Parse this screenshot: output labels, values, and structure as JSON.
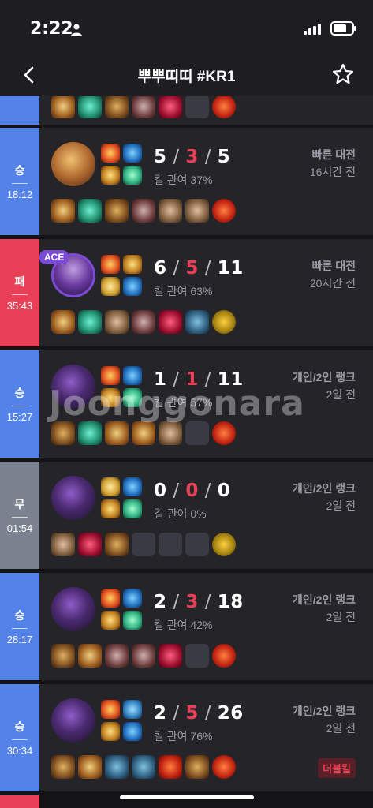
{
  "status_bar": {
    "time": "2:22"
  },
  "header": {
    "title": "뿌뿌띠띠 #KR1"
  },
  "matches": [
    {
      "result": "승",
      "duration": "18:12",
      "kills": "5",
      "deaths": "3",
      "assists": "5",
      "kill_participation": "킬 관여 37%",
      "queue": "빠른 대전",
      "time_ago": "16시간 전"
    },
    {
      "result": "패",
      "duration": "35:43",
      "kills": "6",
      "deaths": "5",
      "assists": "11",
      "kill_participation": "킬 관여 63%",
      "queue": "빠른 대전",
      "time_ago": "20시간 전",
      "badge": "ACE"
    },
    {
      "result": "승",
      "duration": "15:27",
      "kills": "1",
      "deaths": "1",
      "assists": "11",
      "kill_participation": "킬 관여 57%",
      "queue": "개인/2인 랭크",
      "time_ago": "2일 전"
    },
    {
      "result": "무",
      "duration": "01:54",
      "kills": "0",
      "deaths": "0",
      "assists": "0",
      "kill_participation": "킬 관여 0%",
      "queue": "개인/2인 랭크",
      "time_ago": "2일 전"
    },
    {
      "result": "승",
      "duration": "28:17",
      "kills": "2",
      "deaths": "3",
      "assists": "18",
      "kill_participation": "킬 관여 42%",
      "queue": "개인/2인 랭크",
      "time_ago": "2일 전"
    },
    {
      "result": "승",
      "duration": "30:34",
      "kills": "2",
      "deaths": "5",
      "assists": "26",
      "kill_participation": "킬 관여 76%",
      "queue": "개인/2인 랭크",
      "time_ago": "2일 전",
      "multikill": "더블킬"
    }
  ],
  "watermark": "Joonggonara",
  "colors": {
    "win": "#5383e8",
    "loss": "#e84057",
    "draw": "#7b8390"
  }
}
